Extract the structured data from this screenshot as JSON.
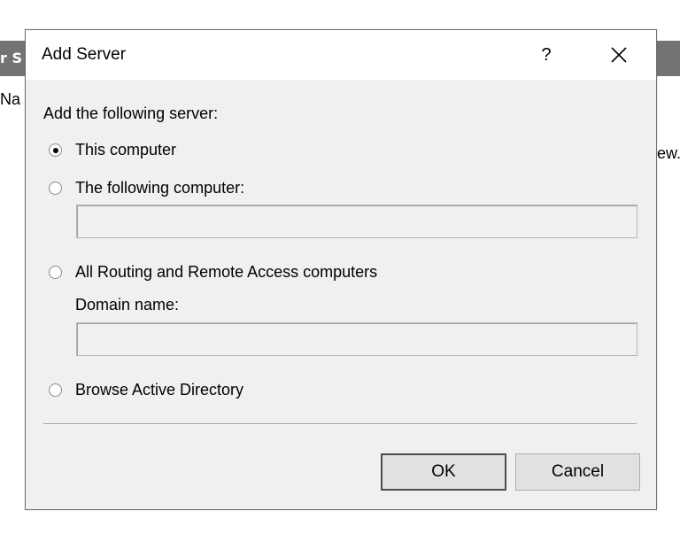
{
  "background": {
    "title_fragment": "r S",
    "left_text_fragment": "Na",
    "right_text_fragment": "ew."
  },
  "dialog": {
    "title": "Add Server",
    "help_label": "?",
    "close_icon": "close-icon",
    "intro_label": "Add the following server:",
    "options": {
      "this_computer": "This computer",
      "following_computer": "The following computer:",
      "all_routing": "All Routing and Remote Access computers",
      "browse_ad": "Browse Active Directory"
    },
    "selected_option": "this_computer",
    "following_computer_value": "",
    "domain_name_label": "Domain name:",
    "domain_name_value": "",
    "buttons": {
      "ok": "OK",
      "cancel": "Cancel"
    }
  }
}
